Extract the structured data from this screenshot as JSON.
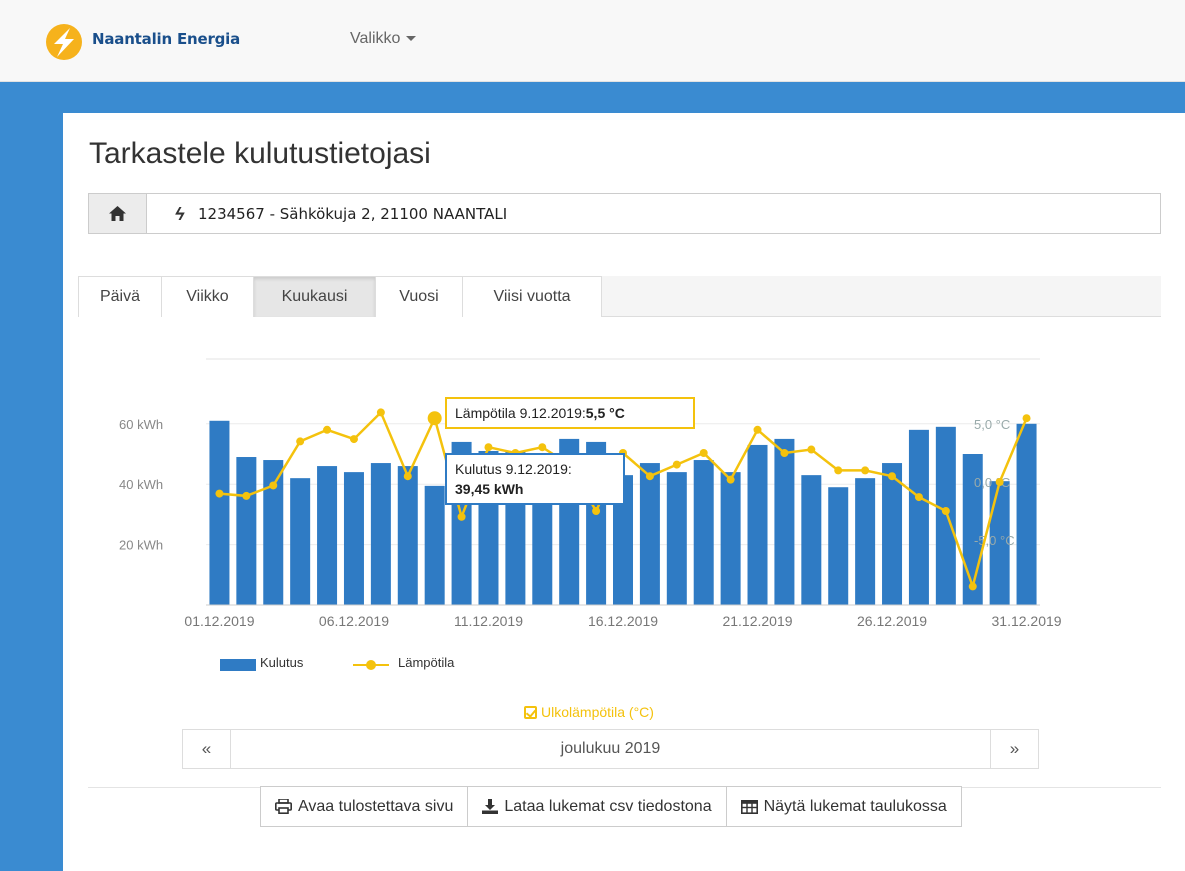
{
  "header": {
    "brand": "Naantalin Energia",
    "menu_label": "Valikko"
  },
  "page": {
    "title": "Tarkastele kulutustietojasi"
  },
  "breadcrumb": {
    "site": "1234567 - Sähkökuja 2, 21100 NAANTALI"
  },
  "tabs": [
    {
      "label": "Päivä",
      "active": false
    },
    {
      "label": "Viikko",
      "active": false
    },
    {
      "label": "Kuukausi",
      "active": true
    },
    {
      "label": "Vuosi",
      "active": false
    },
    {
      "label": "Viisi vuotta",
      "active": false
    }
  ],
  "colors": {
    "bar": "#2f7bc4",
    "temperature": "#f4c20d",
    "accent": "#3a8bd1"
  },
  "chart_data": {
    "type": "bar",
    "categories": [
      "01.12.2019",
      "02.12.2019",
      "03.12.2019",
      "04.12.2019",
      "05.12.2019",
      "06.12.2019",
      "07.12.2019",
      "08.12.2019",
      "09.12.2019",
      "10.12.2019",
      "11.12.2019",
      "12.12.2019",
      "13.12.2019",
      "14.12.2019",
      "15.12.2019",
      "16.12.2019",
      "17.12.2019",
      "18.12.2019",
      "19.12.2019",
      "20.12.2019",
      "21.12.2019",
      "22.12.2019",
      "23.12.2019",
      "24.12.2019",
      "25.12.2019",
      "26.12.2019",
      "27.12.2019",
      "28.12.2019",
      "29.12.2019",
      "30.12.2019",
      "31.12.2019"
    ],
    "x_tick_labels": [
      "01.12.2019",
      "06.12.2019",
      "11.12.2019",
      "16.12.2019",
      "21.12.2019",
      "26.12.2019",
      "31.12.2019"
    ],
    "series": [
      {
        "name": "Kulutus",
        "axis": "left",
        "unit": "kWh",
        "values": [
          61,
          49,
          48,
          42,
          46,
          44,
          47,
          46,
          39.45,
          54,
          51,
          51,
          50,
          55,
          54,
          43,
          47,
          44,
          48,
          44,
          53,
          55,
          43,
          39,
          42,
          47,
          58,
          59,
          50,
          41,
          60
        ]
      },
      {
        "name": "Lämpötila",
        "axis": "right",
        "unit": "°C",
        "values": [
          -1,
          -1.2,
          -0.3,
          3.5,
          4.5,
          3.7,
          6.0,
          0.5,
          5.5,
          -3.0,
          3.0,
          2.5,
          3.0,
          1.5,
          -2.5,
          2.5,
          0.5,
          1.5,
          2.5,
          0.2,
          4.5,
          2.5,
          2.8,
          1.0,
          1.0,
          0.5,
          -1.3,
          -2.5,
          -9.0,
          0.0,
          5.5
        ]
      }
    ],
    "y_left": {
      "ticks": [
        20,
        40,
        60
      ],
      "tick_labels": [
        "20 kWh",
        "40 kWh",
        "60 kWh"
      ],
      "min": 0,
      "max": 80
    },
    "y_right": {
      "ticks": [
        -5,
        0,
        5
      ],
      "tick_labels": [
        "-5,0 °C",
        "0,0 °C",
        "5,0 °C"
      ]
    },
    "grid": true,
    "legend": {
      "position": "bottom-left",
      "items": [
        "Kulutus",
        "Lämpötila"
      ]
    },
    "tooltips": {
      "temperature": {
        "label": "Lämpötila 9.12.2019:",
        "value": "5,5 °C"
      },
      "consumption": {
        "label": "Kulutus 9.12.2019:",
        "value": "39,45 kWh"
      }
    }
  },
  "temperature_toggle": {
    "label": "Ulkolämpötila (°C)",
    "checked": true
  },
  "pager": {
    "prev": "«",
    "next": "»",
    "period": "joulukuu 2019"
  },
  "actions": {
    "print": "Avaa tulostettava sivu",
    "csv": "Lataa lukemat csv tiedostona",
    "table": "Näytä lukemat taulukossa"
  }
}
